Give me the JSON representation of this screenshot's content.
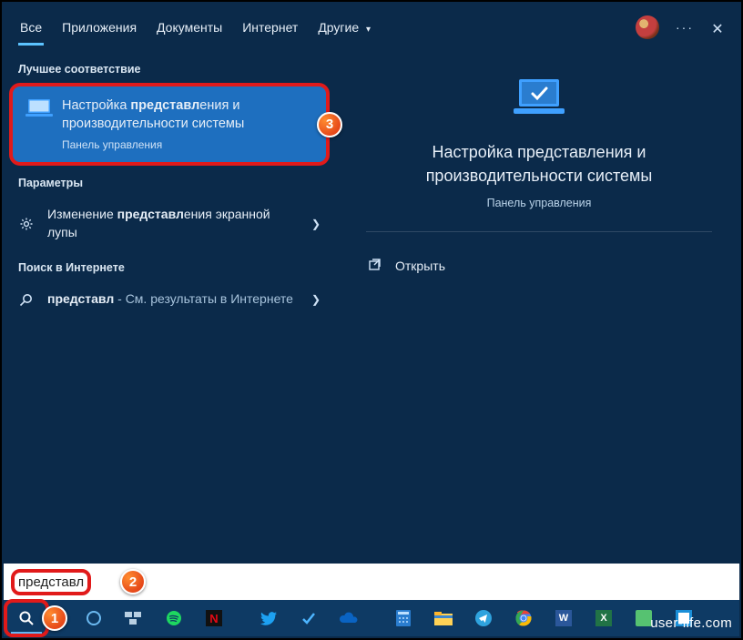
{
  "tabs": {
    "all": "Все",
    "apps": "Приложения",
    "docs": "Документы",
    "internet": "Интернет",
    "other": "Другие"
  },
  "sections": {
    "best_match": "Лучшее соответствие",
    "parameters": "Параметры",
    "web_search": "Поиск в Интернете"
  },
  "best": {
    "title_prefix": "Настройка ",
    "title_bold": "представл",
    "title_suffix": "ения и производительности системы",
    "subtitle": "Панель управления"
  },
  "results": {
    "params_prefix": "Изменение ",
    "params_bold": "представл",
    "params_suffix": "ения экранной лупы",
    "web_bold": "представл",
    "web_suffix": " - См. результаты в Интернете"
  },
  "detail": {
    "title": "Настройка представления и производительности системы",
    "subtitle": "Панель управления",
    "open": "Открыть"
  },
  "search": {
    "value": "представл"
  },
  "badges": {
    "b1": "1",
    "b2": "2",
    "b3": "3"
  },
  "watermark": "user-life.com"
}
